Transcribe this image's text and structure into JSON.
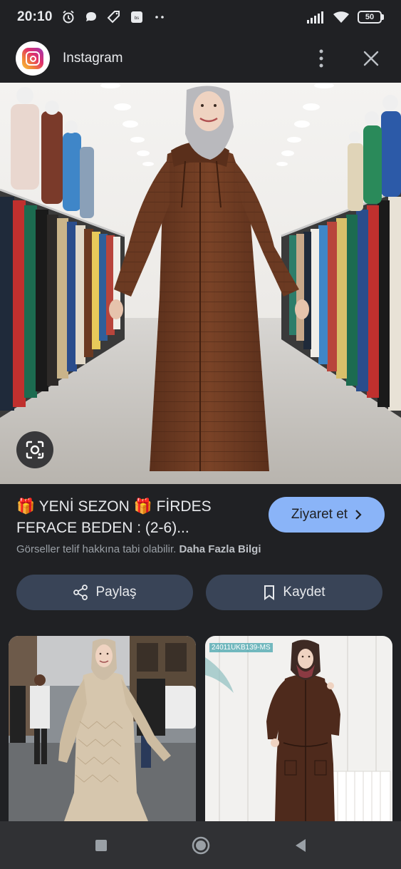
{
  "status_bar": {
    "time": "20:10",
    "battery": "50",
    "notif_icons": [
      "alarm-icon",
      "chat-bubble-icon",
      "tag-icon",
      "app-badge-icon",
      "more-dots-icon"
    ],
    "right_icons": [
      "signal-icon",
      "wifi-icon",
      "battery-icon"
    ]
  },
  "header": {
    "app_name": "Instagram",
    "logo_icon": "instagram-logo",
    "menu_icon": "more-vert-icon",
    "close_icon": "close-icon"
  },
  "main_image": {
    "lens_icon": "google-lens-icon"
  },
  "result": {
    "title": "🎁 YENİ SEZON 🎁 FİRDES FERACE BEDEN : (2-6)...",
    "visit_label": "Ziyaret et",
    "copyright_text": "Görseller telif hakkına tabi olabilir.",
    "more_info": "Daha Fazla Bilgi"
  },
  "actions": {
    "share_label": "Paylaş",
    "save_label": "Kaydet"
  },
  "related": {
    "thumb2_code": "24011UKB139-MS"
  },
  "nav": {
    "icons": [
      "recents-square-icon",
      "home-circle-icon",
      "back-triangle-icon"
    ]
  },
  "colors": {
    "background": "#202124",
    "accent_button": "#8ab4f8",
    "action_button": "#394457",
    "coat_brown": "#6b3a22"
  }
}
